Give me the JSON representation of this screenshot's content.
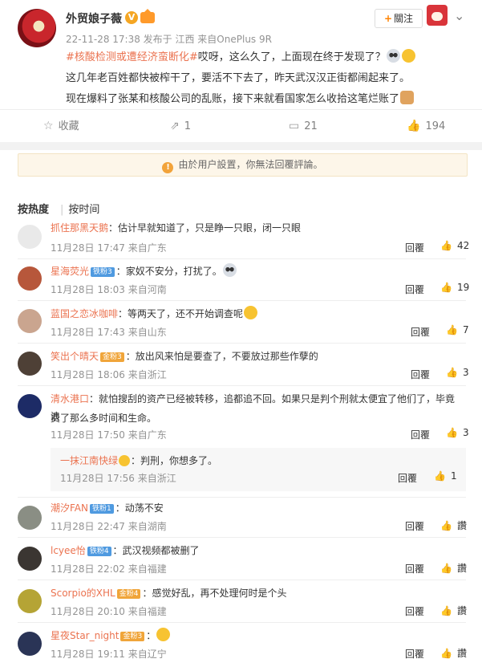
{
  "post": {
    "username": "外贸娘子薇",
    "verified_badge": "V",
    "meta": "22-11-28 17:38 发布于 江西 来自OnePlus 9R",
    "follow_label": "關注",
    "text_topic": "#核酸检测或遭经济蛮断化#",
    "text_line1": "哎呀，这么久了，上面现在终于发现了？",
    "text_line2": "这几年老百姓都快被榨干了，要活不下去了，昨天武汉汉正街都闹起来了。",
    "text_line3": "现在爆料了张某和核酸公司的乱账，接下来就看国家怎么收拾这笔烂账了"
  },
  "actions": {
    "favorite": "收藏",
    "repost": "1",
    "comment": "21",
    "like": "194"
  },
  "notice": "由於用户設置，你無法回覆評論。",
  "sort": {
    "hot": "按热度",
    "time": "按时间"
  },
  "reply_label": "回覆",
  "comments": [
    {
      "name": "抓住那黑天鹅",
      "badge": "",
      "text": "：估计早就知道了，只是睁一只眼，闭一只眼",
      "time": "11月28日 17:47 来自广东",
      "likes": "42"
    },
    {
      "name": "星海荧光",
      "badge": "铁粉3",
      "text": "：家奴不安分，打扰了。",
      "time": "11月28日 18:03 来自河南",
      "likes": "19"
    },
    {
      "name": "蓝国之恋冰咖啡",
      "badge": "",
      "text": "：等两天了，还不开始调查呢",
      "time": "11月28日 17:43 来自山东",
      "likes": "7"
    },
    {
      "name": "笑出个晴天",
      "badge": "金粉3",
      "text": "：放出风来怕是要查了，不要放过那些作孽的",
      "time": "11月28日 18:06 来自浙江",
      "likes": "3"
    },
    {
      "name": "清水港口",
      "badge": "",
      "text": "：就怕搜刮的资产已经被转移，追都追不回。如果只是判个刑就太便宜了他们了，毕竟浪",
      "text2": "费了那么多时间和生命。",
      "time": "11月28日 17:50 来自广东",
      "likes": "3"
    },
    {
      "name": "潮汐FAN",
      "badge": "铁粉1",
      "text": "：动荡不安",
      "time": "11月28日 22:47 来自湖南",
      "likes": "讚"
    },
    {
      "name": "lcyee怡",
      "badge": "铁粉4",
      "text": "：武汉视频都被删了",
      "time": "11月28日 22:02 来自福建",
      "likes": "讚"
    },
    {
      "name": "Scorpio的XHL",
      "badge": "金粉4",
      "text": "：感觉好乱，再不处理何时是个头",
      "time": "11月28日 20:10 来自福建",
      "likes": "讚"
    },
    {
      "name": "星夜Star_night",
      "badge": "金粉3",
      "text": "：",
      "time": "11月28日 19:11 来自辽宁",
      "likes": "讚"
    }
  ],
  "subreply": {
    "name": "一抹江南快绿",
    "text": "：判刑，你想多了。",
    "time": "11月28日 17:56 来自浙江",
    "likes": "1"
  }
}
